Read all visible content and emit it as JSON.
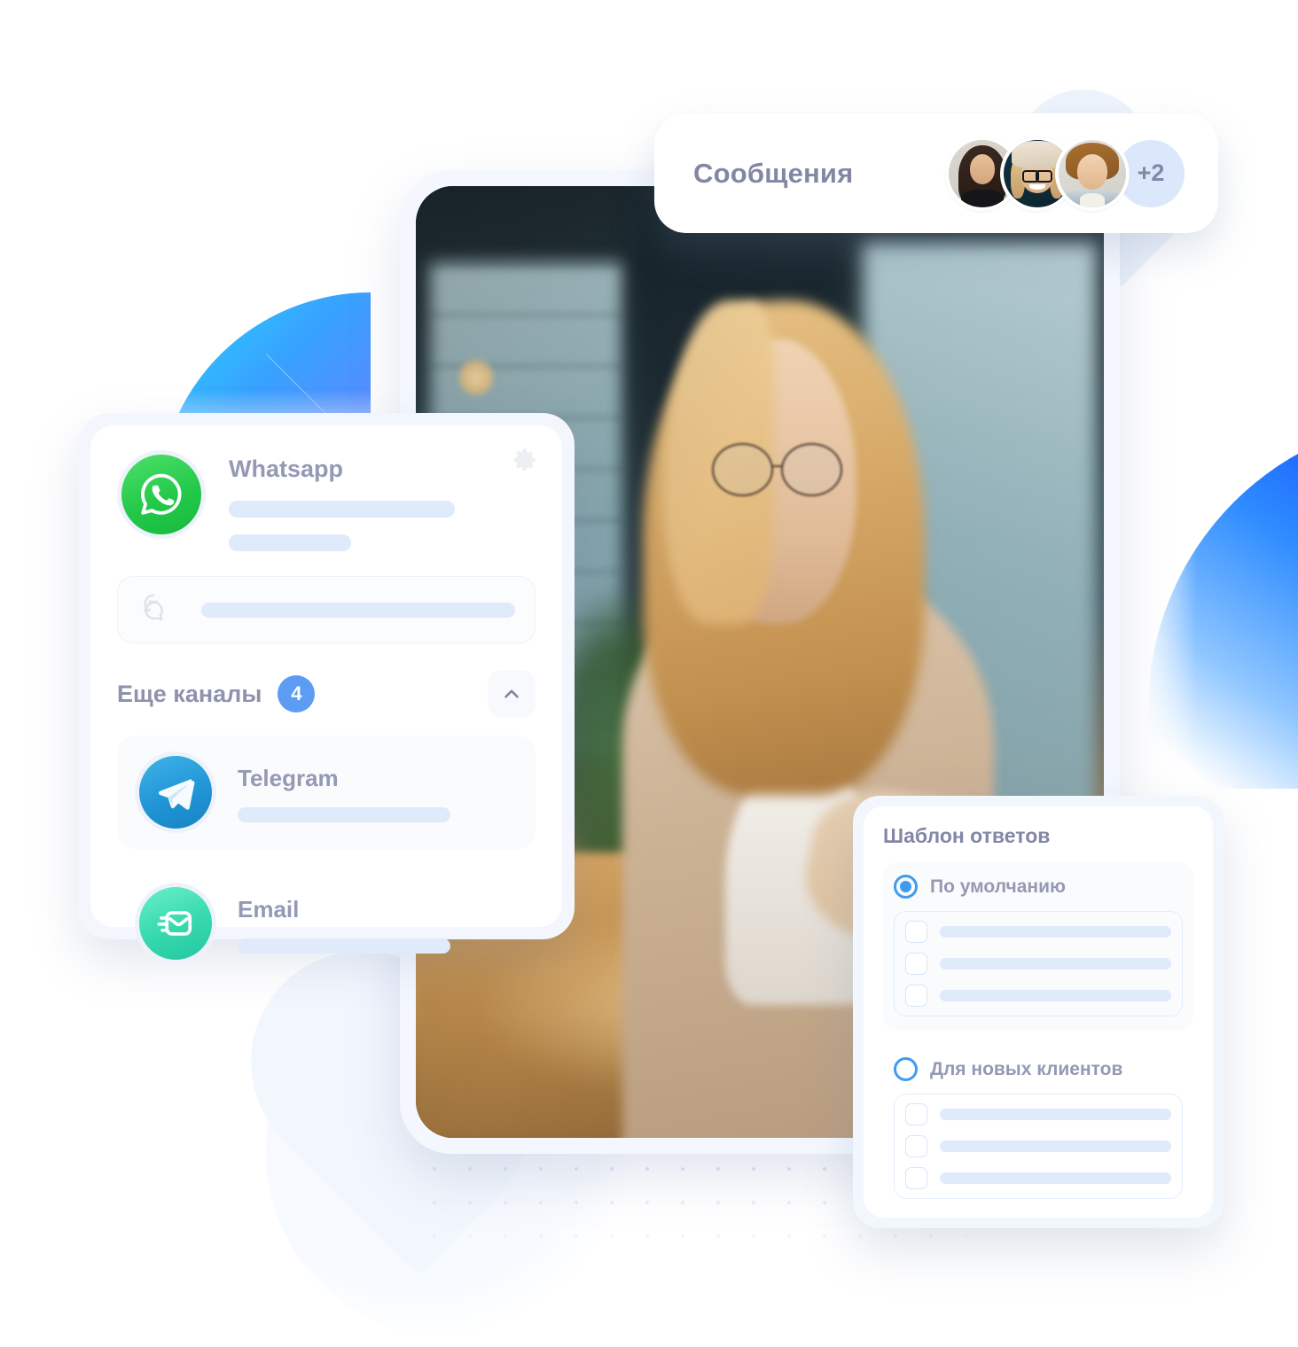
{
  "messages_bar": {
    "title": "Сообщения",
    "avatars": [
      {
        "name": "avatar-woman-dark-hair"
      },
      {
        "name": "avatar-woman-beanie-glasses"
      },
      {
        "name": "avatar-man-long-hair"
      }
    ],
    "more_count": "+2"
  },
  "channels_card": {
    "primary": {
      "name": "Whatsapp",
      "icon": "whatsapp-icon",
      "settings_icon": "gear-icon"
    },
    "search": {
      "icon": "chat-bubbles-icon",
      "placeholder": ""
    },
    "more_channels": {
      "label": "Еще каналы",
      "count": "4",
      "toggle_icon": "chevron-up-icon"
    },
    "items": [
      {
        "name": "Telegram",
        "icon": "telegram-icon"
      },
      {
        "name": "Email",
        "icon": "email-icon"
      }
    ]
  },
  "templates_card": {
    "title": "Шаблон ответов",
    "options": [
      {
        "label": "По умолчанию",
        "selected": true,
        "rows": 3
      },
      {
        "label": "Для новых клиентов",
        "selected": false,
        "rows": 3
      }
    ]
  },
  "colors": {
    "accent_blue": "#5c9df3",
    "radio_blue": "#3f9bf0",
    "muted_text": "#9499b4",
    "title_text": "#8287a6",
    "placeholder_bar": "#dfeafb",
    "card_frame": "#f2f6fd",
    "whatsapp_green": "#24c94a",
    "telegram_blue": "#1f93d4",
    "email_teal": "#37d8ae"
  }
}
